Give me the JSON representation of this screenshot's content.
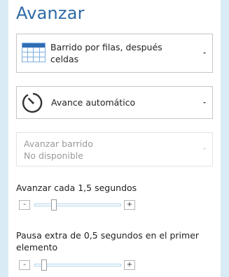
{
  "panel": {
    "title": "Avanzar"
  },
  "order_dropdown": {
    "line1": "Barrido por filas, después",
    "line2": "celdas",
    "icon": "grid-rows-icon"
  },
  "mode_dropdown": {
    "label": "Avance automático",
    "icon": "timer-icon"
  },
  "sweep_dropdown": {
    "line1": "Avanzar barrido",
    "line2": "No disponible",
    "enabled": false
  },
  "advance_interval": {
    "label": "Avanzar cada 1,5 segundos",
    "minus": "-",
    "plus": "+",
    "level": 0.2
  },
  "first_item_pause": {
    "label_line1": "Pausa extra de 0,5 segundos en el primer",
    "label_line2": "elemento",
    "minus": "-",
    "plus": "+",
    "level": 0.1
  },
  "colors": {
    "background": "#d9ecf6",
    "title": "#2e6aa6",
    "grid_icon_top": "#2f6db5",
    "grid_icon_cells": "#7fb0e0",
    "slider_track": "#b0d3ea"
  }
}
